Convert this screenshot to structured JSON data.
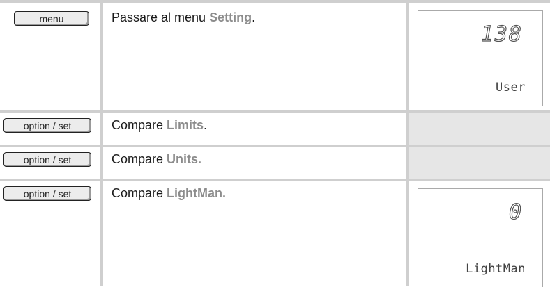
{
  "rows": [
    {
      "key": "menu",
      "text_before": "Passare al menu ",
      "highlight": "Setting",
      "text_after": ".",
      "display": {
        "value": "138",
        "label": "User"
      }
    },
    {
      "key": "option / set",
      "text_before": "Compare ",
      "highlight": "Limits",
      "text_after": "."
    },
    {
      "key": "option / set",
      "text_before": "Compare ",
      "highlight": "Units.",
      "text_after": ""
    },
    {
      "key": "option / set",
      "text_before": "Compare ",
      "highlight": "LightMan.",
      "text_after": "",
      "display": {
        "value": "0",
        "label": "LightMan"
      }
    }
  ],
  "colors": {
    "grid_line": "#cfcfcf",
    "highlight_text": "#8c8c8c",
    "empty_display_cell": "#e6e6e6"
  }
}
